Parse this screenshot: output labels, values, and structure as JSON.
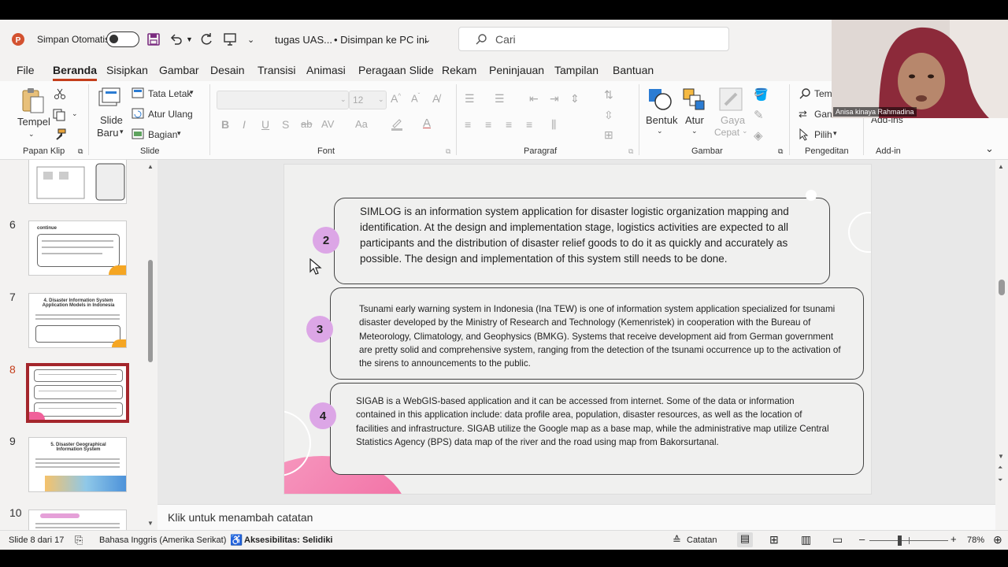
{
  "titlebar": {
    "autosave_label": "Simpan Otomatis",
    "doc_title": "tugas UAS...",
    "save_status": "• Disimpan ke PC ini",
    "save_status_caret": "⌄",
    "search_placeholder": "Cari"
  },
  "menu": [
    "File",
    "Beranda",
    "Sisipkan",
    "Gambar",
    "Desain",
    "Transisi",
    "Animasi",
    "Peragaan Slide",
    "Rekam",
    "Peninjauan",
    "Tampilan",
    "Bantuan"
  ],
  "ribbon": {
    "paste": "Tempel",
    "new_slide_1": "Slide",
    "new_slide_2": "Baru",
    "layout": "Tata Letak",
    "reset": "Atur Ulang",
    "section": "Bagian",
    "font_size": "12",
    "shape": "Bentuk",
    "arrange": "Atur",
    "quick_style_1": "Gaya",
    "quick_style_2": "Cepat",
    "find": "Temu",
    "replace": "Gan",
    "select": "Pilih",
    "addin": "Add-ins",
    "groups": {
      "clipboard": "Papan Klip",
      "slide": "Slide",
      "font": "Font",
      "paragraph": "Paragraf",
      "drawing": "Gambar",
      "editing": "Pengeditan",
      "addins": "Add-in"
    }
  },
  "webcam": {
    "name": "Anisa kinaya Rahmadina"
  },
  "thumbnails": [
    {
      "number": "6",
      "title": "continue"
    },
    {
      "number": "7",
      "title": "4. Disaster Information System Application Models in Indonesia"
    },
    {
      "number": "8",
      "title": ""
    },
    {
      "number": "9",
      "title": "5. Disaster Geographical Information System"
    },
    {
      "number": "10",
      "title": ""
    }
  ],
  "slide": {
    "cards": [
      {
        "number": "2",
        "text": "SIMLOG is an information system application for disaster logistic organization mapping and identification. At the design and implementation stage, logistics activities are expected to all participants and the distribution of disaster relief goods to do it as quickly and accurately as possible. The design and implementation of this system still needs to be done."
      },
      {
        "number": "3",
        "text": "Tsunami early warning system in Indonesia (Ina TEW) is one of information system application specialized for tsunami disaster developed by the Ministry of Research and Technology (Kemenristek) in cooperation with the Bureau of Meteorology, Climatology, and Geophysics (BMKG). Systems that receive development aid from German government are pretty solid and comprehensive system, ranging from the detection of the tsunami occurrence up to the activation of the sirens to announcements to the public."
      },
      {
        "number": "4",
        "text": "SIGAB is a WebGIS-based application and it can be accessed from internet. Some of the data or information contained in this application include: data profile area, population, disaster resources, as well as the location of facilities and infrastructure. SIGAB utilize the Google map as a base map, while the administrative map utilize Central Statistics Agency (BPS) data map of the river and the road using map from Bakorsurtanal."
      }
    ]
  },
  "notes": {
    "placeholder": "Klik untuk menambah catatan"
  },
  "status": {
    "slide_info": "Slide 8 dari 17",
    "language": "Bahasa Inggris (Amerika Serikat)",
    "accessibility": "Aksesibilitas: Selidiki",
    "notes_btn": "Catatan",
    "zoom": "78%",
    "zoom_level": 0.78
  },
  "colors": {
    "accent": "#c43e1c",
    "bubble": "#dca6e6",
    "pink_shape": "#f0609a"
  }
}
